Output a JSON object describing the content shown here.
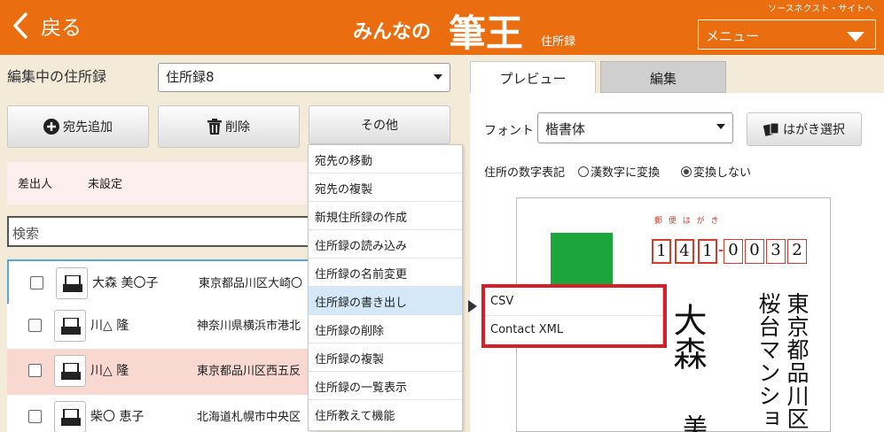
{
  "header": {
    "back_label": "戻る",
    "logo_prefix": "みんなの",
    "logo_main": "筆王",
    "logo_suffix": "住所録",
    "source_link": "ソースネクスト・サイトへ",
    "menu_label": "メニュー"
  },
  "left": {
    "edit_label": "編集中の住所録",
    "addressbook_selected": "住所録8",
    "add_button": "宛先追加",
    "delete_button": "削除",
    "other_button": "その他",
    "sender_label": "差出人",
    "sender_value": "未設定",
    "search_placeholder": "検索",
    "rows": [
      {
        "name": "大森 美〇子",
        "address": "東京都品川区大崎〇"
      },
      {
        "name": "川△ 隆",
        "address": "神奈川県横浜市港北"
      },
      {
        "name": "川△ 隆",
        "address": "東京都品川区西五反"
      },
      {
        "name": "柴〇 恵子",
        "address": "北海道札幌市中央区"
      }
    ]
  },
  "dropdown": {
    "items": [
      "宛先の移動",
      "宛先の複製",
      "新規住所録の作成",
      "住所録の読み込み",
      "住所録の名前変更",
      "住所録の書き出し",
      "住所録の削除",
      "住所録の複製",
      "住所録の一覧表示",
      "住所教えて機能"
    ],
    "submenu": [
      "CSV",
      "Contact XML"
    ]
  },
  "right": {
    "tab_preview": "プレビュー",
    "tab_edit": "編集",
    "font_label": "フォント",
    "font_selected": "楷書体",
    "postcard_button": "はがき選択",
    "number_format_label": "住所の数字表記",
    "radio_kanji": "漢数字に変換",
    "radio_none": "変換しない"
  },
  "postcard": {
    "title": "郵 便 は が き",
    "postal_digits": [
      "1",
      "4",
      "1",
      "0",
      "0",
      "3",
      "2"
    ],
    "name_chars": "大森",
    "name_next": "美",
    "address_line1": "東京都品川区",
    "address_line2": "桜台マンショ"
  },
  "colors": {
    "header_orange": "#ea6d0f",
    "highlight_red": "#d81f28",
    "stamp_green": "#1ba53a",
    "postal_red": "#d43b2d"
  }
}
